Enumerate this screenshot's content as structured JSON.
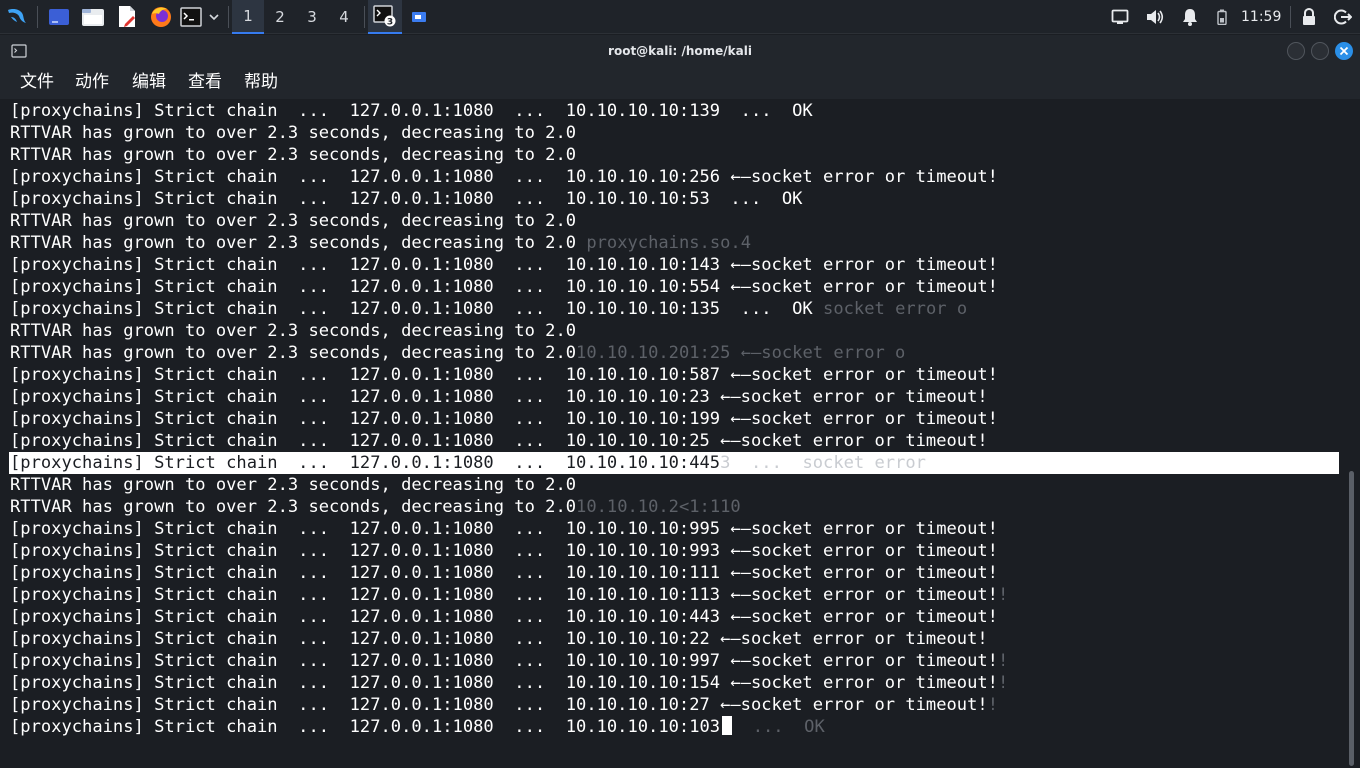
{
  "taskbar": {
    "workspaces": [
      "1",
      "2",
      "3",
      "4"
    ],
    "active_workspace": "1",
    "terminal_badge": "3",
    "clock": "11:59",
    "icons": [
      "kali-dragon-icon",
      "show-desktop-icon",
      "file-manager-icon",
      "text-editor-icon",
      "firefox-icon",
      "terminal-icon",
      "chevron-down-icon",
      "terminal-task-icon",
      "window-task-icon",
      "display-icon",
      "volume-icon",
      "bell-icon",
      "battery-icon",
      "lock-icon",
      "logout-icon"
    ]
  },
  "window": {
    "title": "root@kali: /home/kali"
  },
  "menu": {
    "file": "文件",
    "action": "动作",
    "edit": "编辑",
    "view": "查看",
    "help": "帮助"
  },
  "terminal": {
    "lines": [
      {
        "text": "[proxychains] Strict chain  ...  127.0.0.1:1080  ...  10.10.10.10:139  ...  OK",
        "ghost": ""
      },
      {
        "text": "RTTVAR has grown to over 2.3 seconds, decreasing to 2.0",
        "ghost": ""
      },
      {
        "text": "RTTVAR has grown to over 2.3 seconds, decreasing to 2.0",
        "ghost": ""
      },
      {
        "text": "[proxychains] Strict chain  ...  127.0.0.1:1080  ...  10.10.10.10:256 ←—socket error or timeout!",
        "ghost": ""
      },
      {
        "text": "[proxychains] Strict chain  ...  127.0.0.1:1080  ...  10.10.10.10:53  ...  OK",
        "ghost": ""
      },
      {
        "text": "RTTVAR has grown to over 2.3 seconds, decreasing to 2.0",
        "ghost": ""
      },
      {
        "text": "RTTVAR has grown to over 2.3 seconds, decreasing to 2.0",
        "ghost": " proxychains.so.4"
      },
      {
        "text": "[proxychains] Strict chain  ...  127.0.0.1:1080  ...  10.10.10.10:143 ←—socket error or timeout!",
        "ghost": ""
      },
      {
        "text": "[proxychains] Strict chain  ...  127.0.0.1:1080  ...  10.10.10.10:554 ←—socket error or timeout!",
        "ghost": ""
      },
      {
        "text": "[proxychains] Strict chain  ...  127.0.0.1:1080  ...  10.10.10.10:135  ...  OK",
        "ghost": " socket error o"
      },
      {
        "text": "RTTVAR has grown to over 2.3 seconds, decreasing to 2.0",
        "ghost": ""
      },
      {
        "text": "RTTVAR has grown to over 2.3 seconds, decreasing to 2.0",
        "ghost": "10.10.10.201:25 ←—socket error o"
      },
      {
        "text": "[proxychains] Strict chain  ...  127.0.0.1:1080  ...  10.10.10.10:587 ←—socket error or timeout!",
        "ghost": ""
      },
      {
        "text": "[proxychains] Strict chain  ...  127.0.0.1:1080  ...  10.10.10.10:23 ←—socket error or timeout!",
        "ghost": ""
      },
      {
        "text": "[proxychains] Strict chain  ...  127.0.0.1:1080  ...  10.10.10.10:199 ←—socket error or timeout!",
        "ghost": ""
      },
      {
        "text": "[proxychains] Strict chain  ...  127.0.0.1:1080  ...  10.10.10.10:25 ←—socket error or timeout!",
        "ghost": ""
      },
      {
        "text": "[proxychains] Strict chain  ...  127.0.0.1:1080  ...  10.10.10.10:445",
        "ghost": "3  ...  socket error",
        "highlight": true
      },
      {
        "text": "RTTVAR has grown to over 2.3 seconds, decreasing to 2.0",
        "ghost": ""
      },
      {
        "text": "RTTVAR has grown to over 2.3 seconds, decreasing to 2.0",
        "ghost": "10.10.10.2<1:110"
      },
      {
        "text": "[proxychains] Strict chain  ...  127.0.0.1:1080  ...  10.10.10.10:995 ←—socket error or timeout!",
        "ghost": ""
      },
      {
        "text": "[proxychains] Strict chain  ...  127.0.0.1:1080  ...  10.10.10.10:993 ←—socket error or timeout!",
        "ghost": ""
      },
      {
        "text": "[proxychains] Strict chain  ...  127.0.0.1:1080  ...  10.10.10.10:111 ←—socket error or timeout!",
        "ghost": ""
      },
      {
        "text": "[proxychains] Strict chain  ...  127.0.0.1:1080  ...  10.10.10.10:113 ←—socket error or timeout!",
        "ghost": "!"
      },
      {
        "text": "[proxychains] Strict chain  ...  127.0.0.1:1080  ...  10.10.10.10:443 ←—socket error or timeout!",
        "ghost": ""
      },
      {
        "text": "[proxychains] Strict chain  ...  127.0.0.1:1080  ...  10.10.10.10:22 ←—socket error or timeout!",
        "ghost": ""
      },
      {
        "text": "[proxychains] Strict chain  ...  127.0.0.1:1080  ...  10.10.10.10:997 ←—socket error or timeout!",
        "ghost": "!"
      },
      {
        "text": "[proxychains] Strict chain  ...  127.0.0.1:1080  ...  10.10.10.10:154 ←—socket error or timeout!",
        "ghost": "!"
      },
      {
        "text": "[proxychains] Strict chain  ...  127.0.0.1:1080  ...  10.10.10.10:27 ←—socket error or timeout!",
        "ghost": "!"
      },
      {
        "text": "[proxychains] Strict chain  ...  127.0.0.1:1080  ...  10.10.10.10:103",
        "ghost": "  ...  OK",
        "cursor": true
      }
    ]
  },
  "colors": {
    "taskbar_bg": "#1f2329",
    "accent": "#367bf0",
    "terminal_bg": "#1b1e23",
    "close_button": "#2a8fe8",
    "text": "#ffffff"
  }
}
